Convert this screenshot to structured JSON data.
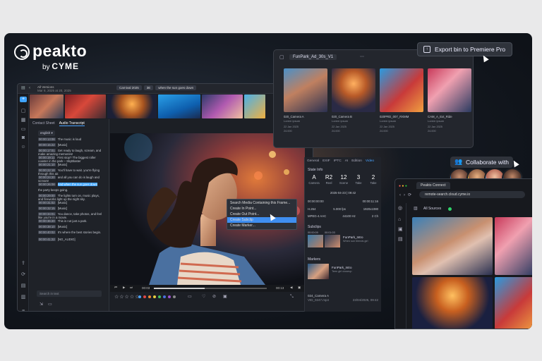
{
  "brand": {
    "name": "peakto",
    "by": "by",
    "company": "CYME"
  },
  "export_button": {
    "label": "Export bin to Premiere Pro",
    "icon": "export-icon"
  },
  "collab": {
    "label": "Collaborate with",
    "icon": "people-icon"
  },
  "clip_window": {
    "title": "FunPark_Ad_30s_V1",
    "clips": [
      {
        "name": "020_Camera A",
        "sub": "Lorem ipsum",
        "date": "22 Jan 2025",
        "fps": "24.000"
      },
      {
        "name": "020_Camera B",
        "sub": "Lorem ipsum",
        "date": "22 Jan 2025",
        "fps": "24.000"
      },
      {
        "name": "020PRD_007_RXMM",
        "sub": "Lorem ipsum",
        "date": "22 Jan 2025",
        "fps": "24.000"
      },
      {
        "name": "CAM_A_Ext_Ride",
        "sub": "Lorem ipsum",
        "date": "22 Jan 2025",
        "fps": "24.000"
      }
    ]
  },
  "main_window": {
    "title": "All Versions",
    "subtitle": "Mar 8, 2025 at 20, 2025",
    "tabs": [
      "Carnival 2025",
      "3E",
      "when the sun goes down"
    ],
    "left_panel": {
      "tabs": [
        "Contact Sheet",
        "Audio Transcript"
      ],
      "language": "english",
      "lines": [
        {
          "tc": "00:00:13:08",
          "text": "The music is loud"
        },
        {
          "tc": "00:00:15:22",
          "text": "[Music]"
        },
        {
          "tc": "00:00:17:01",
          "text": "Get ready to laugh, scream, and make amazing memories!"
        },
        {
          "tc": "00:00:19:11",
          "text": "First stop? The biggest roller coaster in the park – SkyBlaster"
        },
        {
          "tc": "00:00:21:10",
          "text": "[Music]"
        },
        {
          "tc": "00:00:22:18",
          "text": "You'll have to wait. you're flying through this air."
        },
        {
          "tc": "00:00:24:20",
          "text": "and all you can do is laugh and scream!"
        },
        {
          "tc": "00:00:26:08",
          "text": "And when the sun goes down",
          "highlight": "when the sun goes down"
        },
        {
          "tc": "",
          "text": "the party keeps going."
        },
        {
          "tc": "00:00:29:00",
          "text": "The lights turn on, music plays, and fireworks light up the night sky."
        },
        {
          "tc": "00:00:31:02",
          "text": "[Music]"
        },
        {
          "tc": "00:00:32:15",
          "text": "[Music]"
        },
        {
          "tc": "00:00:34:01",
          "text": "You dance, take photos, and feel like you're in a movie."
        },
        {
          "tc": "00:00:36:20",
          "text": "This is not just a park."
        },
        {
          "tc": "00:00:38:10",
          "text": "[Music]"
        },
        {
          "tc": "00:00:40:02",
          "text": "It's where the best stories begin."
        },
        {
          "tc": "00:00:41:22",
          "text": "[NO_AUDIO]"
        }
      ],
      "search_placeholder": "Search in text"
    },
    "context_menu": [
      "Search Media Containing this Frame...",
      "Create In Point...",
      "Create Out Point...",
      "Create Subclip",
      "Create Marker..."
    ],
    "context_menu_active": 3,
    "controls": {
      "time_start": "00:03",
      "time_end": "00:13"
    },
    "right_panel": {
      "tabs": [
        "General",
        "EXIF",
        "IPTC",
        "AI",
        "Edition",
        "Video"
      ],
      "active_tab": 5,
      "state_info": "State Info",
      "stats": [
        {
          "value": "A",
          "label": "Camera"
        },
        {
          "value": "R2",
          "label": "Reel"
        },
        {
          "value": "12",
          "label": "Scene"
        },
        {
          "value": "3",
          "label": "Take"
        },
        {
          "value": "2",
          "label": "Take"
        }
      ],
      "date": "2025-04-23 | 09:42",
      "rows": [
        [
          "00:00:00:00",
          "00:00:11:16"
        ],
        [
          "H.264",
          "5.000 fps",
          "1920x1080"
        ],
        [
          "MPEG-4 AAC",
          "44100 Hz",
          "2 Ch"
        ]
      ],
      "subclips_label": "Subclips",
      "subclip": {
        "tc_in": "00:00:09",
        "tc_out": "00:01:03",
        "name": "FunPark_Intro",
        "desc": "When sun blends girl"
      },
      "markers_label": "Markers",
      "marker": {
        "name": "FunPark_Intro",
        "desc": "Teen girl closeup"
      },
      "footer": {
        "name": "024_Camera A",
        "file": "VID_0247.mp4",
        "date": "23/04/2025, 09:42"
      }
    }
  },
  "browser": {
    "tab": "Peakto Connect",
    "url": "remote-search.cloud.cyme.io",
    "sources_label": "All Sources"
  },
  "colors": {
    "accent": "#3fa4ff",
    "bg": "#151a22",
    "menu_active": "#3f8ef0"
  }
}
